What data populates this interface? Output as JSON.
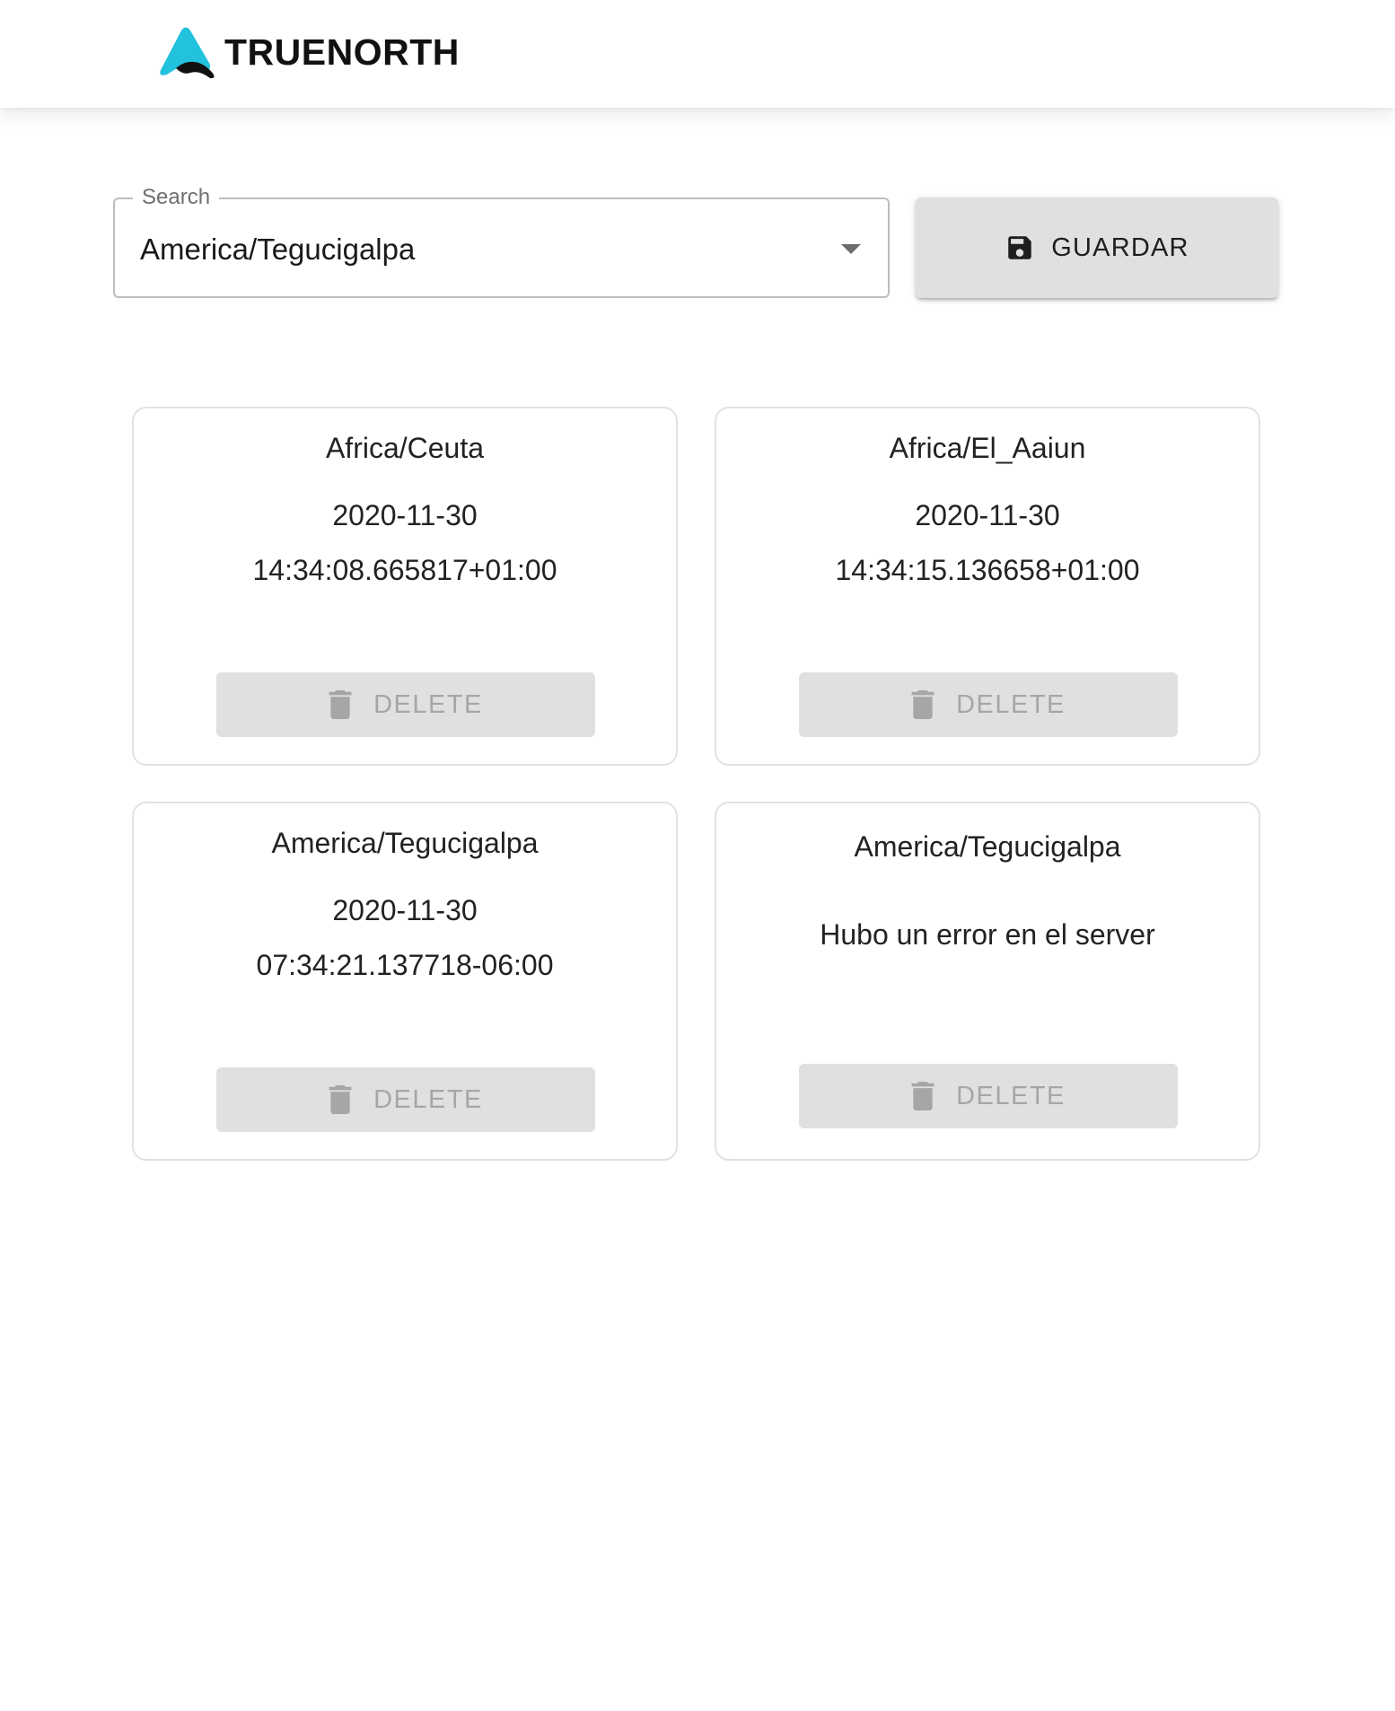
{
  "header": {
    "brand": "TRUENORTH",
    "logo_icon": "truenorth-logo-icon",
    "logo_colors": {
      "primary": "#22C1DC",
      "secondary": "#111111"
    }
  },
  "search": {
    "legend": "Search",
    "value": "America/Tegucigalpa",
    "dropdown_icon": "caret-down-icon"
  },
  "save_button": {
    "label": "GUARDAR",
    "icon": "floppy-disk-icon"
  },
  "cards": [
    {
      "timezone": "Africa/Ceuta",
      "date": "2020-11-30",
      "time": "14:34:08.665817+01:00",
      "delete_label": "DELETE"
    },
    {
      "timezone": "Africa/El_Aaiun",
      "date": "2020-11-30",
      "time": "14:34:15.136658+01:00",
      "delete_label": "DELETE"
    },
    {
      "timezone": "America/Tegucigalpa",
      "date": "2020-11-30",
      "time": "07:34:21.137718-06:00",
      "delete_label": "DELETE"
    },
    {
      "timezone": "America/Tegucigalpa",
      "error": "Hubo un error en el server",
      "delete_label": "DELETE"
    }
  ]
}
